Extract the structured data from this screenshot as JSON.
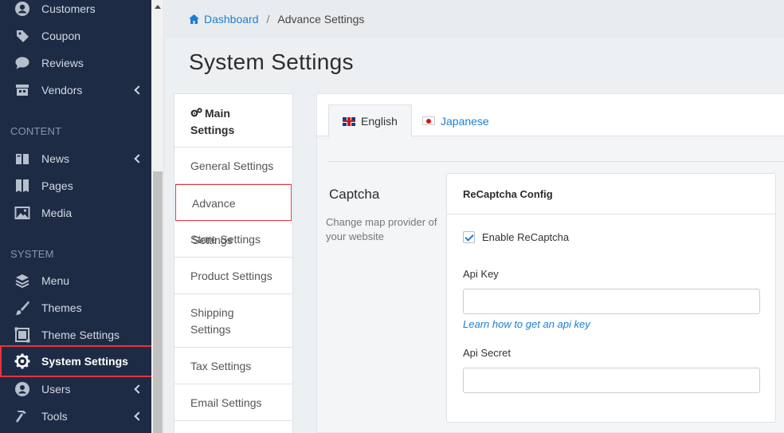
{
  "sidebar": {
    "items_top": [
      {
        "label": "Customers",
        "icon": "user-circle-icon"
      },
      {
        "label": "Coupon",
        "icon": "tag-icon"
      },
      {
        "label": "Reviews",
        "icon": "comment-icon"
      },
      {
        "label": "Vendors",
        "icon": "store-icon",
        "has_children": true
      }
    ],
    "section_content": "CONTENT",
    "items_content": [
      {
        "label": "News",
        "icon": "book-icon",
        "has_children": true
      },
      {
        "label": "Pages",
        "icon": "pages-icon"
      },
      {
        "label": "Media",
        "icon": "image-icon"
      }
    ],
    "section_system": "SYSTEM",
    "items_system": [
      {
        "label": "Menu",
        "icon": "layers-icon"
      },
      {
        "label": "Themes",
        "icon": "brush-icon"
      },
      {
        "label": "Theme Settings",
        "icon": "theme-settings-icon"
      },
      {
        "label": "System Settings",
        "icon": "gear-icon",
        "active": true
      },
      {
        "label": "Users",
        "icon": "users-icon",
        "has_children": true
      },
      {
        "label": "Tools",
        "icon": "hammer-icon",
        "has_children": true
      }
    ]
  },
  "breadcrumb": {
    "home": "Dashboard",
    "separator": "/",
    "current": "Advance Settings"
  },
  "page_title": "System Settings",
  "settings_menu": {
    "heading_line1": "Main",
    "heading_line2": "Settings",
    "items": [
      "General Settings",
      "Advance Settings",
      "Store Settings",
      "Product Settings",
      "Shipping Settings",
      "Tax Settings",
      "Email Settings"
    ],
    "active": "Advance Settings"
  },
  "tabs": [
    {
      "label": "English",
      "active": true
    },
    {
      "label": "Japanese",
      "active": false
    }
  ],
  "captcha": {
    "title": "Captcha",
    "description": "Change map provider of your website",
    "card_title": "ReCaptcha Config",
    "enable_label": "Enable ReCaptcha",
    "enabled": true,
    "api_key_label": "Api Key",
    "api_key_value": "",
    "help_link": "Learn how to get an api key",
    "api_secret_label": "Api Secret",
    "api_secret_value": ""
  },
  "colors": {
    "sidebar_bg": "#1e2b45",
    "accent": "#1a7fd4",
    "active_border": "#e8333b"
  }
}
